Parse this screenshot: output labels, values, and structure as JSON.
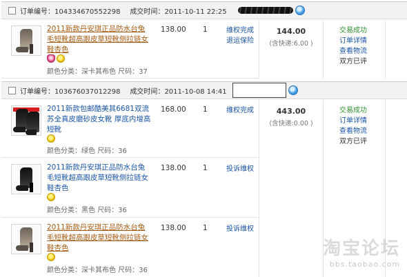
{
  "orders": [
    {
      "order_label": "订单编号：",
      "order_no": "104334670552298",
      "time_label": "成交时间：",
      "time": "2011-10-11 22:25",
      "total": "144.00",
      "shipping": "(含快递:6.00 )",
      "status": [
        "交易成功",
        "订单详情",
        "查看物流",
        "双方已评"
      ],
      "items": [
        {
          "title": "2011新款丹安琪正品防水台兔毛短靴超高跟皮草短靴侧拉链女鞋杏色",
          "attrs": "颜色分类：深卡其布色  尺码：37",
          "price": "138.00",
          "qty": "1",
          "after_sale": [
            "维权完成",
            "退运保险"
          ]
        }
      ]
    },
    {
      "order_label": "订单编号：",
      "order_no": "103676037012298",
      "time_label": "成交时间：",
      "time": "2011-10-08 14:41",
      "total": "443.00",
      "shipping": "(含快递:0.00 )",
      "status": [
        "交易成功",
        "订单详情",
        "查看物流",
        "双方已评"
      ],
      "items": [
        {
          "title": "2011新款包邮酷美其6681双流苏全真皮磨砂皮女靴 厚底内增高短靴",
          "attrs": "颜色分类：绿色  尺码：36",
          "price": "168.00",
          "qty": "1",
          "after_sale": [
            "维权完成"
          ]
        },
        {
          "title": "2011新款丹安琪正品防水台兔毛短靴超高跟皮草短靴侧拉链女鞋杏色",
          "attrs": "颜色分类：黑色  尺码：36",
          "price": "138.00",
          "qty": "1",
          "after_sale": [
            "投诉维权"
          ]
        },
        {
          "title": "2011新款丹安琪正品防水台兔毛短靴超高跟皮草短靴侧拉链女鞋杏色",
          "attrs": "颜色分类：深卡其布色  尺码：36",
          "price": "138.00",
          "qty": "1",
          "after_sale": [
            "投诉维权"
          ]
        }
      ]
    }
  ],
  "watermark": {
    "main": "淘宝论坛",
    "url": "bbs.taobao.com"
  },
  "icons": {
    "wangwang": "wangwang-icon",
    "tag_plant": "plant-tag-icon",
    "tag_coin": "coin-tag-icon"
  }
}
